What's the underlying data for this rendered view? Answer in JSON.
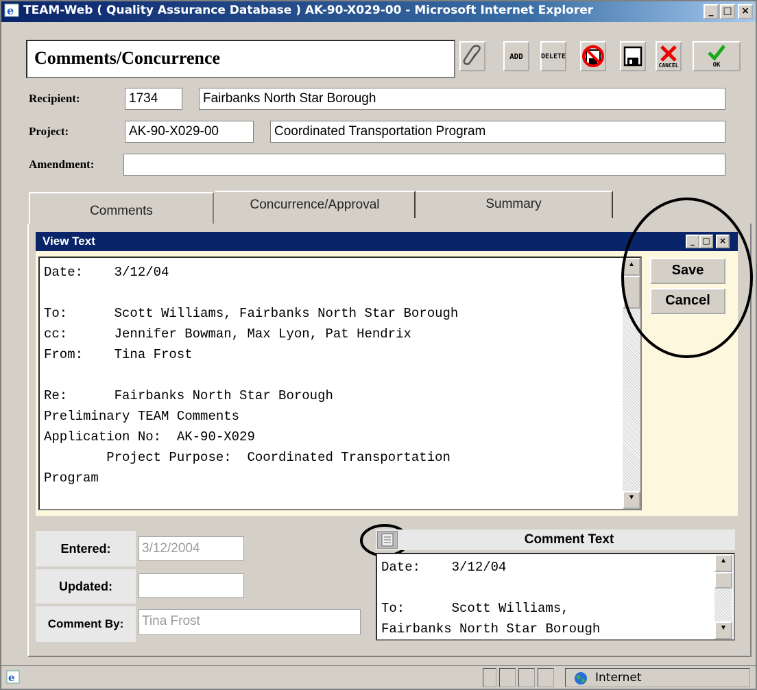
{
  "window": {
    "title": "TEAM-Web ( Quality Assurance Database ) AK-90-X029-00 - Microsoft Internet Explorer",
    "controls": {
      "minimize": "_",
      "maximize": "□",
      "close": "×"
    }
  },
  "header": {
    "form_title": "Comments/Concurrence",
    "toolbar": {
      "add_label": "ADD",
      "delete_label": "DELETE",
      "cancel_label": "CANCEL",
      "ok_label": "OK"
    }
  },
  "fields": {
    "recipient": {
      "label": "Recipient:",
      "code": "1734",
      "name": "Fairbanks North Star Borough"
    },
    "project": {
      "label": "Project:",
      "code": "AK-90-X029-00",
      "name": "Coordinated Transportation Program"
    },
    "amendment": {
      "label": "Amendment:",
      "value": ""
    }
  },
  "tabs": [
    {
      "label": "Comments",
      "active": true
    },
    {
      "label": "Concurrence/Approval",
      "active": false
    },
    {
      "label": "Summary",
      "active": false
    }
  ],
  "view_text": {
    "title": "View Text",
    "lines": [
      "Date:    3/12/04",
      "",
      "To:      Scott Williams, Fairbanks North Star Borough",
      "cc:      Jennifer Bowman, Max Lyon, Pat Hendrix",
      "From:    Tina Frost",
      "",
      "Re:      Fairbanks North Star Borough",
      "Preliminary TEAM Comments",
      "Application No:  AK-90-X029",
      "        Project Purpose:  Coordinated Transportation",
      "Program"
    ],
    "save_label": "Save",
    "cancel_label": "Cancel"
  },
  "details": {
    "entered": {
      "label": "Entered:",
      "value": "3/12/2004"
    },
    "updated": {
      "label": "Updated:",
      "value": ""
    },
    "comment_by": {
      "label": "Comment By:",
      "value": "Tina Frost"
    }
  },
  "comment_text": {
    "header": "Comment Text",
    "lines": [
      "Date:    3/12/04",
      "",
      "To:      Scott Williams,",
      "Fairbanks North Star Borough"
    ]
  },
  "statusbar": {
    "zone": "Internet"
  },
  "colors": {
    "titlebar": "#0a246a",
    "dialog_bg": "#fdf7de",
    "window_bg": "#d4d0c8"
  }
}
